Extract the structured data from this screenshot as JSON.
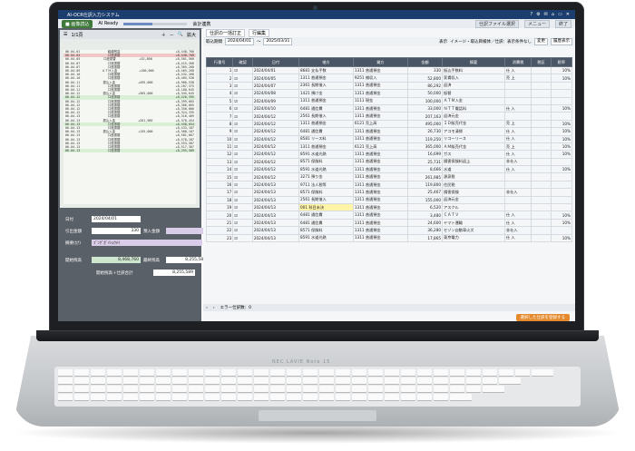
{
  "app": {
    "title": "AI-OCR仕訳入力システム",
    "window_icons": [
      "?",
      "⚙",
      "✉",
      "⌂",
      "▭",
      "✕"
    ]
  },
  "toolbar": {
    "read_button": "■ 画像読込",
    "progress_label": "AI Ready",
    "progress": 0.45,
    "nav_label": "会計連携",
    "file_button": "仕訳ファイル選択",
    "menu_button": "メニュー",
    "exit_button": "終了"
  },
  "docview": {
    "page": "1/1頁",
    "zoom_label": "拡大",
    "receipt_rows": [
      {
        "date": "06-04-01",
        "desc": "繰越残高",
        "amount": "",
        "balance": "+8,448,760",
        "style": ""
      },
      {
        "date": "06-04-04",
        "desc": "口座振替",
        "amount": "",
        "balance": "+8,448,760",
        "style": "hl"
      },
      {
        "date": "06-04-05",
        "desc": "口座振替",
        "amount": "+52,800",
        "balance": "+8,501,560",
        "style": ""
      },
      {
        "date": "06-04-07",
        "desc": "口座振替",
        "amount": "",
        "balance": "+8,415,268",
        "style": ""
      },
      {
        "date": "06-04-07",
        "desc": "口座振替",
        "amount": "",
        "balance": "+8,365,268",
        "style": ""
      },
      {
        "date": "06-04-09",
        "desc": "ＡＴＭ入金",
        "amount": "+100,000",
        "balance": "+8,465,268",
        "style": ""
      },
      {
        "date": "06-04-10",
        "desc": "口座振替",
        "amount": "",
        "balance": "+8,432,268",
        "style": ""
      },
      {
        "date": "06-04-10",
        "desc": "口座振替",
        "amount": "",
        "balance": "+8,405,538",
        "style": ""
      },
      {
        "date": "06-04-11",
        "desc": "振込入金",
        "amount": "+495,000",
        "balance": "+8,900,538",
        "style": ""
      },
      {
        "date": "06-04-11",
        "desc": "口座振替",
        "amount": "",
        "balance": "+8,207,375",
        "style": ""
      },
      {
        "date": "06-04-11",
        "desc": "口座振替",
        "amount": "",
        "balance": "+8,180,645",
        "style": ""
      },
      {
        "date": "06-04-12",
        "desc": "振込入金",
        "amount": "+365,000",
        "balance": "+8,545,645",
        "style": ""
      },
      {
        "date": "06-04-12",
        "desc": "口座振替",
        "amount": "",
        "balance": "+8,426,395",
        "style": "gr"
      },
      {
        "date": "06-04-12",
        "desc": "口座振替",
        "amount": "",
        "balance": "+8,399,665",
        "style": ""
      },
      {
        "date": "06-04-12",
        "desc": "口座振替",
        "amount": "",
        "balance": "+8,366,665",
        "style": ""
      },
      {
        "date": "06-04-12",
        "desc": "口座振替",
        "amount": "",
        "balance": "+8,350,066",
        "style": ""
      },
      {
        "date": "06-04-12",
        "desc": "口座振替",
        "amount": "",
        "balance": "+8,324,335",
        "style": ""
      },
      {
        "date": "06-04-13",
        "desc": "口座振替",
        "amount": "",
        "balance": "+8,316,469",
        "style": ""
      },
      {
        "date": "06-04-13",
        "desc": "振込入金",
        "amount": "+261,985",
        "balance": "+8,578,454",
        "style": ""
      },
      {
        "date": "06-04-13",
        "desc": "口座振替",
        "amount": "",
        "balance": "+8,458,654",
        "style": "gr"
      },
      {
        "date": "06-04-13",
        "desc": "口座振替",
        "amount": "",
        "balance": "+8,433,187",
        "style": ""
      },
      {
        "date": "06-04-13",
        "desc": "振込入金",
        "amount": "+155,000",
        "balance": "+8,588,187",
        "style": ""
      },
      {
        "date": "06-04-13",
        "desc": "口座振替",
        "amount": "",
        "balance": "+8,581,667",
        "style": ""
      },
      {
        "date": "06-04-13",
        "desc": "口座振替",
        "amount": "",
        "balance": "+8,578,187",
        "style": ""
      },
      {
        "date": "06-04-13",
        "desc": "口座振替",
        "amount": "",
        "balance": "+8,553,587",
        "style": ""
      },
      {
        "date": "06-04-13",
        "desc": "口座振替",
        "amount": "",
        "balance": "+8,517,307",
        "style": ""
      },
      {
        "date": "06-04-13",
        "desc": "口座振替",
        "amount": "",
        "balance": "+8,255,589",
        "style": "gr"
      }
    ]
  },
  "form": {
    "date_label": "日付",
    "date_value": "2024/04/01",
    "out_label": "引出金額",
    "out_value": "330",
    "in_label": "預入金額",
    "in_value": "",
    "desc_label": "摘要(ｶﾅ)",
    "desc_value": "ﾌﾞﾝｸﾞｶﾞｲｼｮｳﾒｲ",
    "start_label": "開始残高",
    "start_value": "8,468,760",
    "end_label": "最終残高",
    "end_value": "8,255,589",
    "calc_label": "開始残高＋仕訳合計",
    "calc_value": "8,255,589"
  },
  "right": {
    "tabs": [
      "仕訳の一括訂正",
      "行編集"
    ],
    "filter_label": "取込期間",
    "date_from": "2024/04/01",
    "date_to": "2025/03/31",
    "display_label": "表示",
    "display_value": "イメージ・取込目検体／仕訳：表示条件なし",
    "change_button": "変更",
    "history_button": "履歴表示",
    "columns": [
      "行番号",
      "確認",
      "日付",
      "借方",
      "貸方",
      "金額",
      "摘要",
      "消費税",
      "税区",
      "税率"
    ],
    "rows": [
      {
        "n": "1",
        "d": "2024/04/01",
        "dr": "8681 支払手数",
        "cr": "1311 普通預金",
        "amt": "330",
        "memo": "振込手数料",
        "tax": "仕 入",
        "rate": "10%"
      },
      {
        "n": "2",
        "d": "2024/04/05",
        "dr": "1311 普通預金",
        "cr": "9251 雑収入",
        "amt": "52,800",
        "memo": "家賃収入",
        "tax": "売 上",
        "rate": "10%"
      },
      {
        "n": "3",
        "d": "2024/04/07",
        "dr": "2361 長期借入",
        "cr": "1311 普通預金",
        "amt": "86,292",
        "memo": "返済",
        "tax": "",
        "rate": ""
      },
      {
        "n": "4",
        "d": "2024/04/08",
        "dr": "1421 預け金",
        "cr": "1311 普通預金",
        "amt": "50,000",
        "memo": "振替",
        "tax": "",
        "rate": ""
      },
      {
        "n": "5",
        "d": "2024/04/09",
        "dr": "1311 普通預金",
        "cr": "1111 現金",
        "amt": "100,000",
        "memo": "ＡＴＭ入金",
        "tax": "",
        "rate": ""
      },
      {
        "n": "6",
        "d": "2024/04/10",
        "dr": "6481 通信費",
        "cr": "1311 普通預金",
        "amt": "33,000",
        "memo": "ＮＴＴ電話料",
        "tax": "仕 入",
        "rate": "10%"
      },
      {
        "n": "7",
        "d": "2024/04/12",
        "dr": "2561 長期借入",
        "cr": "1311 普通預金",
        "amt": "207,163",
        "memo": "返済元金",
        "tax": "",
        "rate": ""
      },
      {
        "n": "8",
        "d": "2024/04/12",
        "dr": "1311 普通預金",
        "cr": "6121 売上高",
        "amt": "495,000",
        "memo": "ＩＤ販売代金",
        "tax": "売 上",
        "rate": "10%"
      },
      {
        "n": "9",
        "d": "2024/04/12",
        "dr": "6481 通信費",
        "cr": "1311 普通預金",
        "amt": "26,730",
        "memo": "アコモ清掃",
        "tax": "仕 入",
        "rate": "10%"
      },
      {
        "n": "10",
        "d": "2024/04/12",
        "dr": "8581 リース料",
        "cr": "1311 普通預金",
        "amt": "119,250",
        "memo": "リコーリース",
        "tax": "仕 入",
        "rate": "10%"
      },
      {
        "n": "11",
        "d": "2024/04/12",
        "dr": "1311 普通預金",
        "cr": "6121 売上高",
        "amt": "365,000",
        "memo": "ＡＭ販売代金",
        "tax": "売 上",
        "rate": "10%"
      },
      {
        "n": "12",
        "d": "2024/04/12",
        "dr": "8591 水道光熱",
        "cr": "1311 普通預金",
        "amt": "16,699",
        "memo": "ガス",
        "tax": "仕 入",
        "rate": "10%"
      },
      {
        "n": "13",
        "d": "2024/04/12",
        "dr": "8571 保険料",
        "cr": "1311 普通預金",
        "amt": "25,731",
        "memo": "損害保険料返上",
        "tax": "非仕入",
        "rate": ""
      },
      {
        "n": "14",
        "d": "2024/04/12",
        "dr": "8591 水道光熱",
        "cr": "1311 普通預金",
        "amt": "8,666",
        "memo": "水道",
        "tax": "仕 入",
        "rate": "10%"
      },
      {
        "n": "15",
        "d": "2024/04/12",
        "dr": "3271 預り金",
        "cr": "1311 普通預金",
        "amt": "261,985",
        "memo": "源泉税",
        "tax": "",
        "rate": ""
      },
      {
        "n": "16",
        "d": "2024/04/13",
        "dr": "9711 法人税等",
        "cr": "1311 普通預金",
        "amt": "119,800",
        "memo": "住民税",
        "tax": "",
        "rate": ""
      },
      {
        "n": "17",
        "d": "2024/04/13",
        "dr": "8571 保険料",
        "cr": "1311 普通預金",
        "amt": "25,467",
        "memo": "損害保険",
        "tax": "非仕入",
        "rate": ""
      },
      {
        "n": "18",
        "d": "2024/04/13",
        "dr": "2561 長期借入",
        "cr": "1311 普通預金",
        "amt": "155,000",
        "memo": "返済元金",
        "tax": "",
        "rate": ""
      },
      {
        "n": "19",
        "d": "2024/04/13",
        "dr": "001 科目未決",
        "cr": "1311 普通預金",
        "amt": "6,520",
        "memo": "アスクル",
        "tax": "",
        "rate": ""
      },
      {
        "n": "20",
        "d": "2024/04/13",
        "dr": "6481 通信費",
        "cr": "1311 普通預金",
        "amt": "3,480",
        "memo": "ＣＡＴＶ",
        "tax": "仕 入",
        "rate": "10%"
      },
      {
        "n": "21",
        "d": "2024/04/13",
        "dr": "6481 通信費",
        "cr": "1311 普通預金",
        "amt": "24,600",
        "memo": "ヤマト運輸",
        "tax": "仕 入",
        "rate": "10%"
      },
      {
        "n": "22",
        "d": "2024/04/13",
        "dr": "8571 保険料",
        "cr": "1311 普通預金",
        "amt": "36,280",
        "memo": "セゾン自動車火災",
        "tax": "非仕入",
        "rate": ""
      },
      {
        "n": "23",
        "d": "2024/04/13",
        "dr": "8591 水道光熱",
        "cr": "1311 普通預金",
        "amt": "17,865",
        "memo": "東京電力",
        "tax": "仕 入",
        "rate": "10%"
      }
    ],
    "status": "エラー仕訳数：0",
    "register_button": "選択した仕訳を登録する"
  },
  "laptop": {
    "brand": "NEC LAVIE Note 15"
  }
}
